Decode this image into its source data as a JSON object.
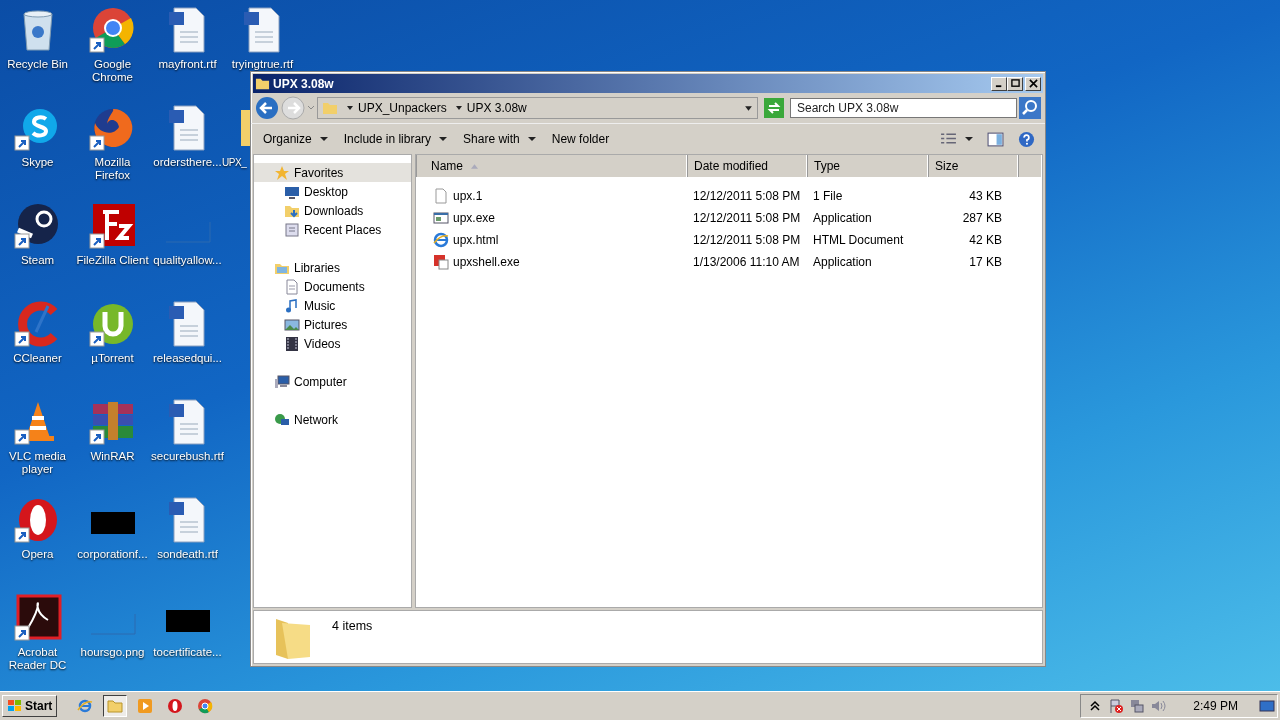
{
  "desktop": {
    "icons": [
      {
        "label": "Recycle Bin",
        "kind": "recycle",
        "shortcut": false
      },
      {
        "label": "Skype",
        "kind": "skype",
        "shortcut": true
      },
      {
        "label": "Steam",
        "kind": "steam",
        "shortcut": true
      },
      {
        "label": "CCleaner",
        "kind": "ccleaner",
        "shortcut": true
      },
      {
        "label": "VLC media player",
        "kind": "vlc",
        "shortcut": true
      },
      {
        "label": "Opera",
        "kind": "opera",
        "shortcut": true
      },
      {
        "label": "Acrobat Reader DC",
        "kind": "acrobat",
        "shortcut": true
      },
      {
        "label": "Google Chrome",
        "kind": "chrome",
        "shortcut": true
      },
      {
        "label": "Mozilla Firefox",
        "kind": "firefox",
        "shortcut": true
      },
      {
        "label": "FileZilla Client",
        "kind": "filezilla",
        "shortcut": true
      },
      {
        "label": "µTorrent",
        "kind": "utorrent",
        "shortcut": true
      },
      {
        "label": "WinRAR",
        "kind": "winrar",
        "shortcut": true
      },
      {
        "label": "corporationf...",
        "kind": "black",
        "shortcut": false
      },
      {
        "label": "hoursgo.png",
        "kind": "blank",
        "shortcut": false
      },
      {
        "label": "mayfront.rtf",
        "kind": "word",
        "shortcut": false
      },
      {
        "label": "ordersthere...",
        "kind": "word",
        "shortcut": false
      },
      {
        "label": "qualityallow...",
        "kind": "blank",
        "shortcut": false
      },
      {
        "label": "releasedqui...",
        "kind": "word",
        "shortcut": false
      },
      {
        "label": "securebush.rtf",
        "kind": "word",
        "shortcut": false
      },
      {
        "label": "sondeath.rtf",
        "kind": "word",
        "shortcut": false
      },
      {
        "label": "tocertificate...",
        "kind": "black",
        "shortcut": false
      },
      {
        "label": "tryingtrue.rtf",
        "kind": "word",
        "shortcut": false
      },
      {
        "label": "UPX_",
        "kind": "folder",
        "shortcut": false
      }
    ]
  },
  "window": {
    "title": "UPX 3.08w",
    "breadcrumb": [
      "UPX_Unpackers",
      "UPX 3.08w"
    ],
    "search": {
      "placeholder": "Search UPX 3.08w"
    },
    "toolbar": [
      {
        "label": "Organize",
        "dropdown": true
      },
      {
        "label": "Include in library",
        "dropdown": true
      },
      {
        "label": "Share with",
        "dropdown": true
      },
      {
        "label": "New folder",
        "dropdown": false
      }
    ],
    "nav": [
      {
        "label": "Favorites",
        "selected": true,
        "children": [
          {
            "label": "Desktop",
            "selected": false
          },
          {
            "label": "Downloads",
            "selected": false
          },
          {
            "label": "Recent Places",
            "selected": false
          }
        ]
      },
      {
        "label": "Libraries",
        "selected": false,
        "children": [
          {
            "label": "Documents",
            "selected": false
          },
          {
            "label": "Music",
            "selected": false
          },
          {
            "label": "Pictures",
            "selected": false
          },
          {
            "label": "Videos",
            "selected": false
          }
        ]
      },
      {
        "label": "Computer",
        "selected": false
      },
      {
        "label": "Network",
        "selected": false
      }
    ],
    "columns": [
      {
        "label": "Name",
        "sorted": true
      },
      {
        "label": "Date modified",
        "sorted": false
      },
      {
        "label": "Type",
        "sorted": false
      },
      {
        "label": "Size",
        "sorted": false
      }
    ],
    "files": [
      {
        "name": "upx.1",
        "date": "12/12/2011 5:08 PM",
        "type": "1 File",
        "size": "43 KB",
        "kind": "file"
      },
      {
        "name": "upx.exe",
        "date": "12/12/2011 5:08 PM",
        "type": "Application",
        "size": "287 KB",
        "kind": "app"
      },
      {
        "name": "upx.html",
        "date": "12/12/2011 5:08 PM",
        "type": "HTML Document",
        "size": "42 KB",
        "kind": "web"
      },
      {
        "name": "upxshell.exe",
        "date": "1/13/2006 11:10 AM",
        "type": "Application",
        "size": "17 KB",
        "kind": "shell"
      }
    ],
    "status": "4 items"
  },
  "taskbar": {
    "start": "Start",
    "apps": [
      {
        "kind": "ie",
        "active": false
      },
      {
        "kind": "explorer",
        "active": true
      },
      {
        "kind": "media",
        "active": false
      },
      {
        "kind": "opera",
        "active": false
      },
      {
        "kind": "chrome",
        "active": false
      }
    ],
    "clock": "2:49 PM"
  }
}
